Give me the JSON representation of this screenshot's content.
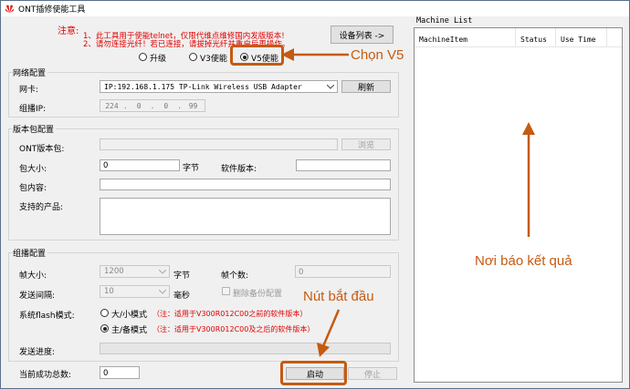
{
  "window": {
    "title": "ONT插修使能工具"
  },
  "notice": {
    "label": "注意:",
    "line1": "1、此工具用于使能telnet，仅限代维点维修国内发版版本!",
    "line2": "2、请勿连接光纤！若已连接，请拔掉光纤并重启后再操作。"
  },
  "buttons": {
    "device_list": "设备列表 ->",
    "refresh": "刷新",
    "browse": "浏览",
    "start": "启动",
    "stop": "停止"
  },
  "modes": [
    {
      "label": "升级",
      "selected": false
    },
    {
      "label": "V3使能",
      "selected": false
    },
    {
      "label": "V5使能",
      "selected": true
    }
  ],
  "network": {
    "title": "网络配置",
    "nic_label": "网卡:",
    "nic_value": "IP:192.168.1.175 TP-Link Wireless USB Adapter",
    "mcast_label": "组播IP:",
    "ip": [
      "224",
      "0",
      "0",
      "99"
    ]
  },
  "package": {
    "title": "版本包配置",
    "ont_label": "ONT版本包:",
    "size_label": "包大小:",
    "size_value": "0",
    "size_unit": "字节",
    "sw_label": "软件版本:",
    "content_label": "包内容:",
    "products_label": "支持的产品:"
  },
  "multicast": {
    "title": "组播配置",
    "frame_label": "帧大小:",
    "frame_value": "1200",
    "frame_unit": "字节",
    "count_label": "帧个数:",
    "count_value": "0",
    "interval_label": "发送间隔:",
    "interval_value": "10",
    "interval_unit": "毫秒",
    "delete_backup": "删除备份配置",
    "flash_label": "系统flash模式:",
    "flash_options": [
      {
        "label": "大/小模式",
        "note": "（注：适用于V300R012C00之前的软件版本）",
        "selected": false
      },
      {
        "label": "主/备模式",
        "note": "（注：适用于V300R012C00及之后的软件版本）",
        "selected": true
      }
    ],
    "progress_label": "发送进度:"
  },
  "success": {
    "label": "当前成功总数:",
    "value": "0"
  },
  "machine_list": {
    "title": "Machine List",
    "columns": [
      "MachineItem",
      "Status",
      "Use Time"
    ]
  },
  "annotations": {
    "choose_v5": "Chọn V5",
    "result_area": "Nơi báo kết quả",
    "start_button": "Nút bắt đầu"
  },
  "colors": {
    "annotation": "#c55a11",
    "notice": "#e00000"
  }
}
